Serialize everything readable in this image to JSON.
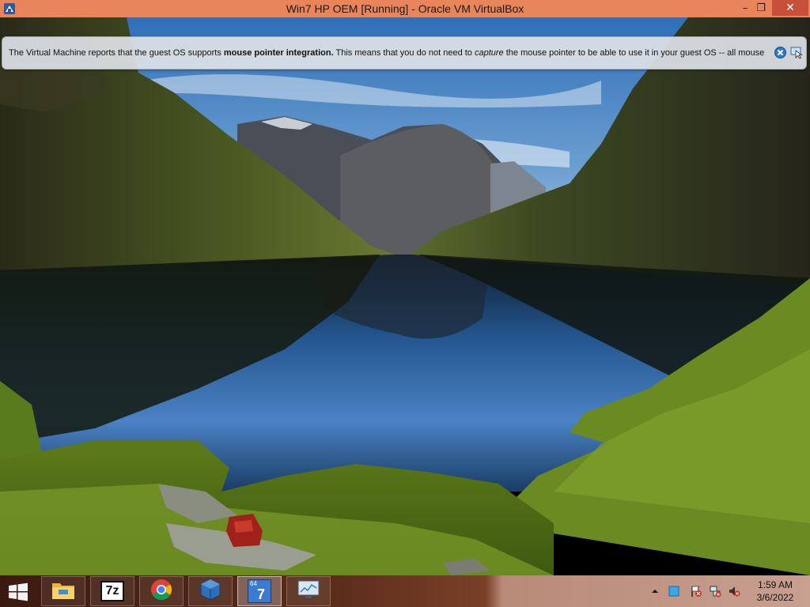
{
  "window": {
    "title": "Win7 HP OEM [Running] - Oracle VM VirtualBox",
    "minimize_glyph": "–",
    "maximize_glyph": "❐",
    "close_glyph": "✕"
  },
  "banner": {
    "text_before": "The Virtual Machine reports that the guest OS supports ",
    "text_bold": "mouse pointer integration.",
    "text_middle": " This means that you do not need to ",
    "text_italic": "capture",
    "text_after": " the mouse pointer to be able to use it in your guest OS -- all mouse"
  },
  "taskbar": {
    "items": [
      {
        "name": "file-explorer",
        "icon": "folder-icon"
      },
      {
        "name": "7zip",
        "label": "7z",
        "icon": "7zip-icon"
      },
      {
        "name": "chrome",
        "icon": "chrome-icon"
      },
      {
        "name": "virtualbox",
        "icon": "virtualbox-icon"
      },
      {
        "name": "windows7-vm",
        "label": "64",
        "sub_label": "7",
        "icon": "win7-vm-icon"
      },
      {
        "name": "system-monitor",
        "icon": "monitor-icon"
      }
    ]
  },
  "tray": {
    "time": "1:59 AM",
    "date": "3/6/2022"
  },
  "colors": {
    "titlebar": "#e9855a",
    "close_button": "#c7503a",
    "taskbar_dark": "#3a1a10",
    "taskbar_light": "#c8a090"
  }
}
